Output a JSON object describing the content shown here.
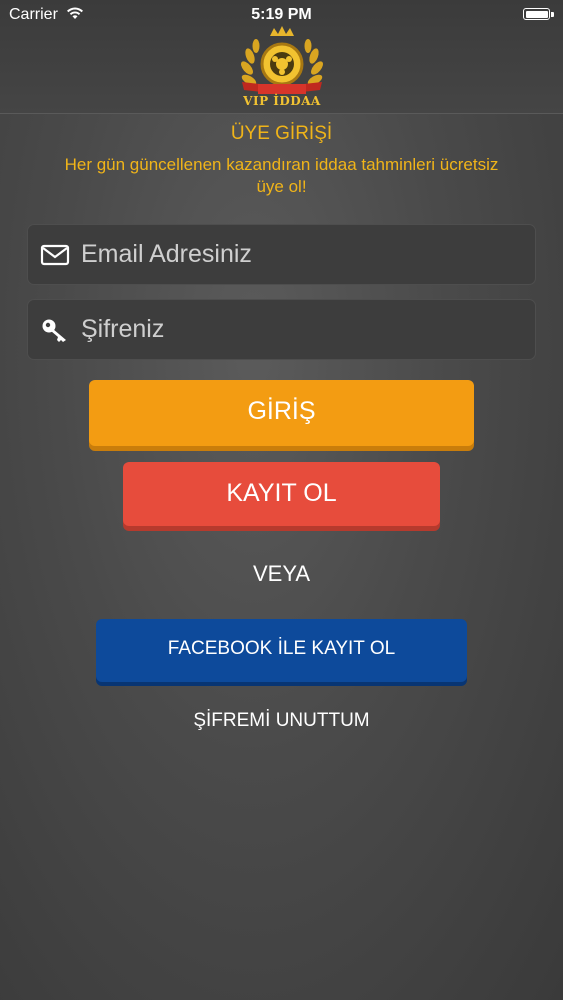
{
  "status_bar": {
    "carrier": "Carrier",
    "time": "5:19 PM"
  },
  "header": {
    "logo_text": "VIP İDDAA"
  },
  "login": {
    "title": "ÜYE GİRİŞİ",
    "subtitle": "Her gün güncellenen kazandıran iddaa tahminleri ücretsiz üye ol!",
    "email_placeholder": "Email Adresiniz",
    "password_placeholder": "Şifreniz",
    "login_label": "GİRİŞ",
    "register_label": "KAYIT OL",
    "or_label": "VEYA",
    "facebook_label": "FACEBOOK İLE KAYIT OL",
    "forgot_label": "ŞİFREMİ UNUTTUM"
  },
  "colors": {
    "accent_orange": "#f39c12",
    "accent_red": "#e74c3c",
    "facebook_blue": "#0d4a9b",
    "title_gold": "#f0b419"
  },
  "icons": {
    "email": "envelope-icon",
    "password": "key-icon",
    "wifi": "wifi-icon",
    "battery": "battery-icon"
  }
}
